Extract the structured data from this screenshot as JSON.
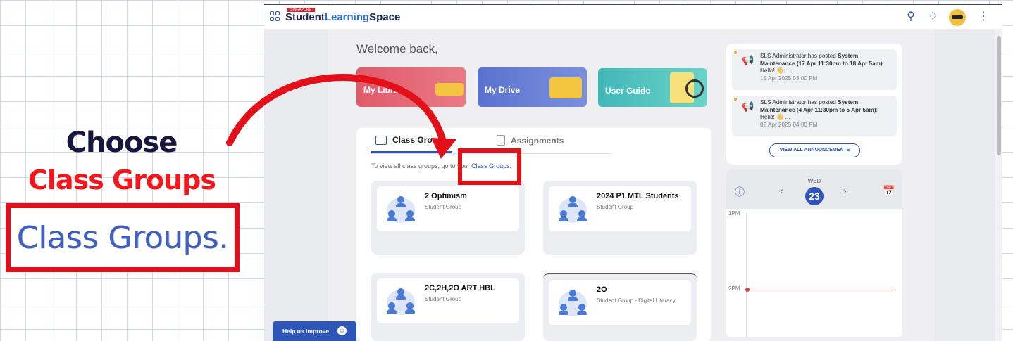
{
  "annotation": {
    "choose": "Choose",
    "highlight": "Class Groups",
    "zoom_text": "Class Groups."
  },
  "header": {
    "brand_first": "Student",
    "brand_learning": "Learning",
    "brand_space": "Space",
    "badge": "SINGAPORE"
  },
  "main": {
    "welcome": "Welcome back,",
    "tiles": [
      {
        "label": "My Library"
      },
      {
        "label": "My Drive"
      },
      {
        "label": "User Guide"
      }
    ],
    "tabs": [
      {
        "label": "Class Groups"
      },
      {
        "label": "Assignments"
      }
    ],
    "info_prefix": "To view all class groups, go to your",
    "info_link": "Class Groups.",
    "groups": [
      {
        "title": "2 Optimism",
        "sub": "Student Group"
      },
      {
        "title": "2024 P1 MTL Students",
        "sub": "Student Group"
      },
      {
        "title": "2C,2H,2O ART HBL",
        "sub": "Student Group"
      },
      {
        "title": "2O",
        "sub": "Student Group - Digital Literacy"
      }
    ]
  },
  "announcements": {
    "items": [
      {
        "prefix": "SLS Administrator has posted ",
        "bold": "System Maintenance (17 Apr 11:30pm to 18 Apr 5am)",
        "suffix": ": Hello! 👋 ...",
        "date": "15 Apr 2025 03:00 PM"
      },
      {
        "prefix": "SLS Administrator has posted ",
        "bold": "System Maintenance (4 Apr 11:30pm to 5 Apr 5am)",
        "suffix": ": Hello! 👋 ...",
        "date": "02 Apr 2025 04:00 PM"
      }
    ],
    "view_all": "VIEW ALL ANNOUNCEMENTS"
  },
  "calendar": {
    "day": "WED",
    "date": "23",
    "time_top": "1PM",
    "time_now": "2PM"
  },
  "help": {
    "label": "Help us improve"
  }
}
